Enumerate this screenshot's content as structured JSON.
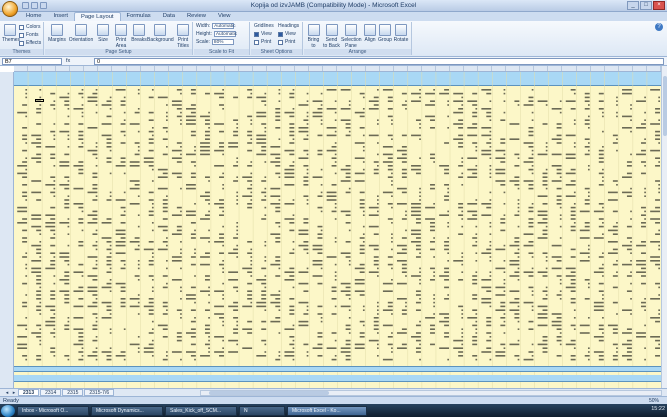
{
  "window": {
    "title": "Kopija od izvJAMB (Compatibility Mode) - Microsoft Excel"
  },
  "tabs": [
    "Home",
    "Insert",
    "Page Layout",
    "Formulas",
    "Data",
    "Review",
    "View"
  ],
  "active_tab": "Page Layout",
  "ribbon": {
    "themes": {
      "big": "Themes",
      "colors": "Colors",
      "fonts": "Fonts",
      "effects": "Effects",
      "group": "Themes"
    },
    "page_setup": {
      "buttons": [
        "Margins",
        "Orientation",
        "Size",
        "Print Area",
        "Breaks",
        "Background",
        "Print Titles"
      ],
      "group": "Page Setup"
    },
    "scale": {
      "width_label": "Width:",
      "width_value": "Automatic",
      "height_label": "Height:",
      "height_value": "Automatic",
      "scale_label": "Scale:",
      "scale_value": "80%",
      "group": "Scale to Fit"
    },
    "sheet_options": {
      "gridlines": "Gridlines",
      "headings": "Headings",
      "view": "View",
      "print": "Print",
      "group": "Sheet Options"
    },
    "arrange": {
      "buttons": [
        "Bring to Front",
        "Send to Back",
        "Selection Pane",
        "Align",
        "Group",
        "Rotate"
      ],
      "group": "Arrange"
    }
  },
  "formula_bar": {
    "name_box": "B7",
    "fx": "fx",
    "value": "0"
  },
  "sheet_tabs": [
    "2313",
    "2314",
    "2315",
    "2315-7/6"
  ],
  "active_sheet": "2313",
  "status": {
    "text": "Ready",
    "zoom": "50%"
  },
  "taskbar": {
    "items": [
      "Inbox - Microsoft O...",
      "Microsoft Dynamics...",
      "Sales_Kick_off_SCM...",
      "N",
      "Microsoft Excel - Ko..."
    ],
    "active": "Microsoft Excel - Ko...",
    "clock": "15:22"
  },
  "colors": {
    "sheet_fill": "#fcf7c8",
    "header_fill": "#a9d8f5",
    "ribbon": "#dde8f5"
  }
}
